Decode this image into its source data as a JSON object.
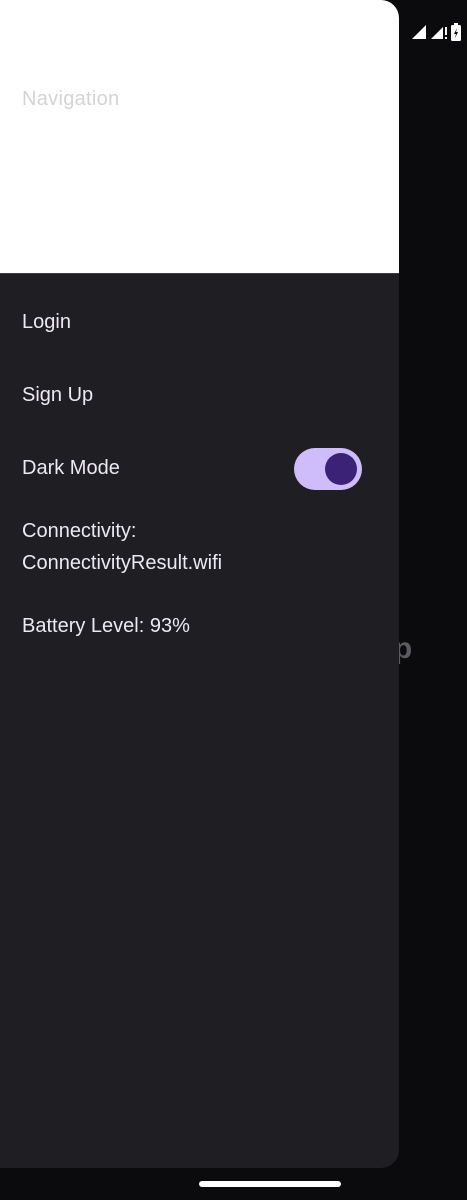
{
  "background_app": {
    "title_fragment": "le Ap"
  },
  "status_bar": {
    "icons": [
      "signal-icon",
      "signal-no-data-icon",
      "battery-icon"
    ]
  },
  "drawer": {
    "header": {
      "title": "Navigation"
    },
    "items": [
      {
        "label": "Login"
      },
      {
        "label": "Sign Up"
      },
      {
        "label": "Dark Mode",
        "toggle_on": true
      }
    ],
    "connectivity_label": "Connectivity:",
    "connectivity_value": "ConnectivityResult.wifi",
    "battery_text": "Battery Level: 93%"
  },
  "colors": {
    "drawer_bg": "#1f1e23",
    "header_bg": "#ffffff",
    "switch_track": "#cfbdfb",
    "switch_thumb": "#3c2277",
    "text": "#ece9f1"
  }
}
